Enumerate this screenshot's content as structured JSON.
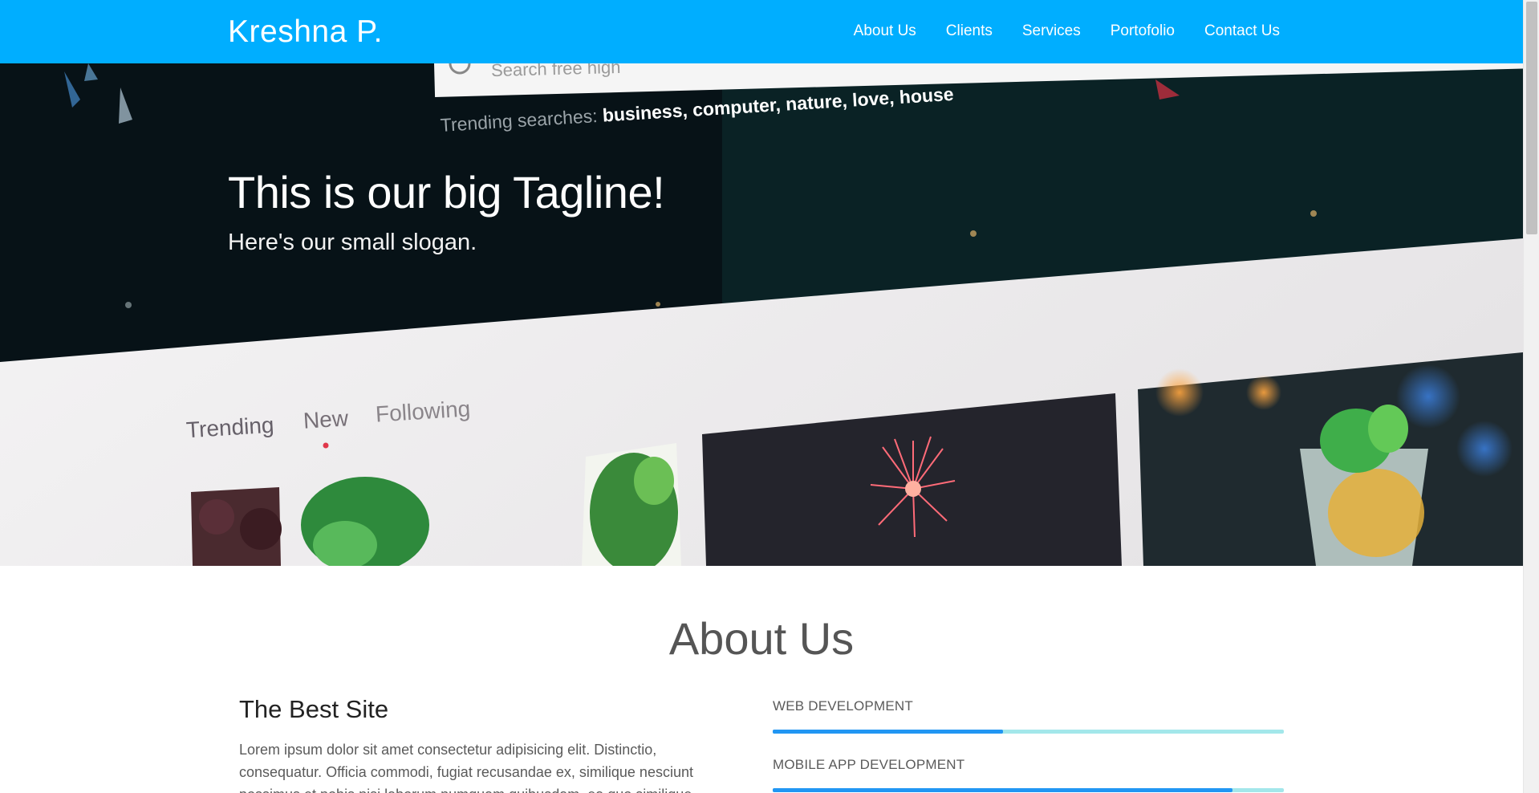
{
  "navbar": {
    "brand": "Kreshna P.",
    "links": [
      "About Us",
      "Clients",
      "Services",
      "Portofolio",
      "Contact Us"
    ]
  },
  "hero": {
    "tagline": "This is our big Tagline!",
    "slogan": "Here's our small slogan.",
    "photo": {
      "search_placeholder": "Search free high",
      "trending_label": "Trending searches:",
      "trending_terms": "business, computer, nature, love, house",
      "tabs": [
        "Trending",
        "New",
        "Following"
      ]
    }
  },
  "about": {
    "title": "About Us",
    "subtitle": "The Best Site",
    "text": "Lorem ipsum dolor sit amet consectetur adipisicing elit. Distinctio, consequatur. Officia commodi, fugiat recusandae ex, similique nesciunt possimus et nobis nisi laborum numquam quibusdam, ea quo similique molestias soluta consectetur.",
    "skills": [
      {
        "label": "WEB DEVELOPMENT",
        "percent": 45
      },
      {
        "label": "MOBILE APP DEVELOPMENT",
        "percent": 90
      }
    ]
  },
  "colors": {
    "navbar": "#00aeff",
    "bar_track": "#a3e7ea",
    "bar_fill": "#2196f3"
  }
}
